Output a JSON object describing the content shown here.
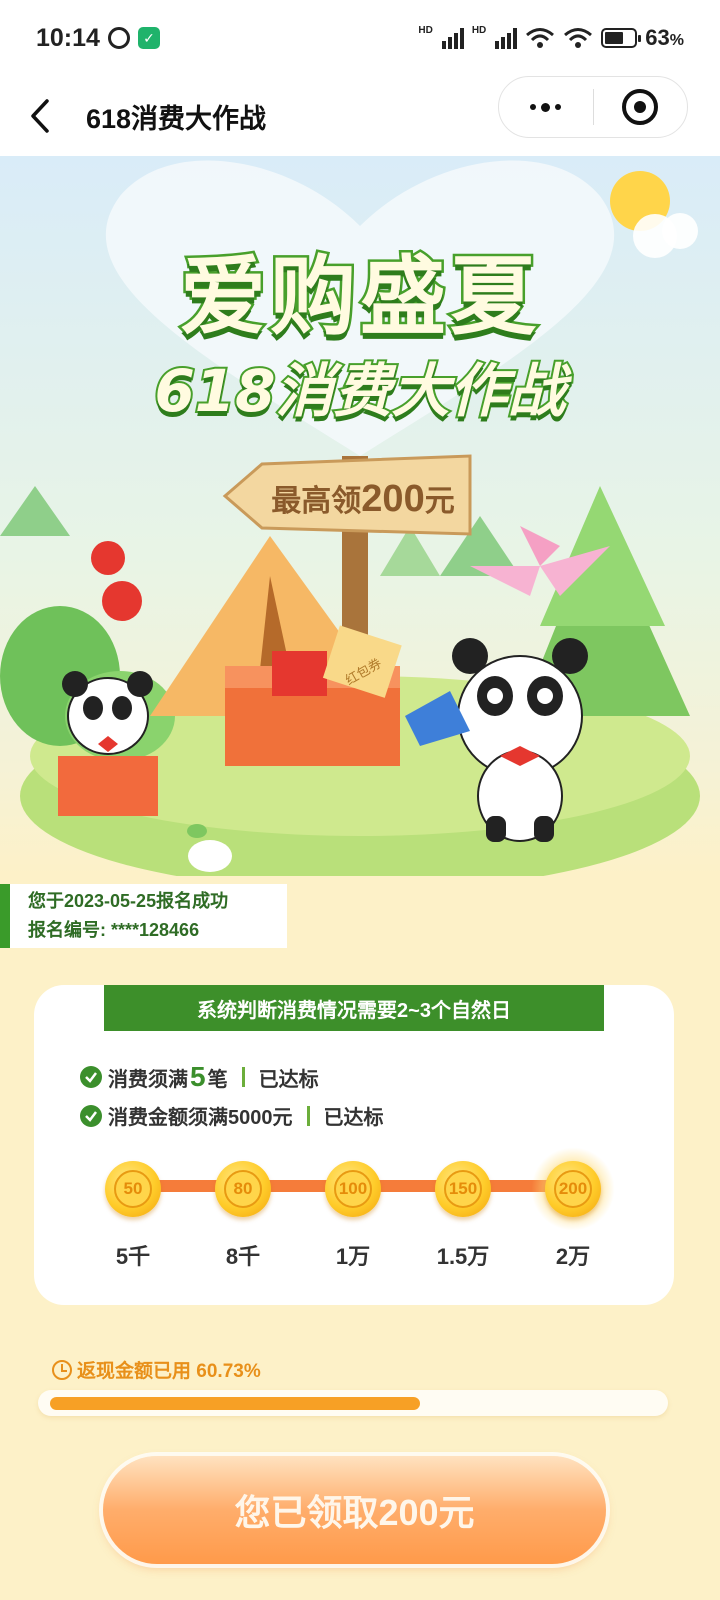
{
  "status_bar": {
    "time": "10:14",
    "signal1": "HD",
    "signal2": "HD",
    "battery": "63",
    "battery_unit": "%"
  },
  "nav": {
    "title": "618消费大作战"
  },
  "hero": {
    "title": "爱购盛夏",
    "subtitle": "618消费大作战",
    "sign_prefix": "最高领",
    "sign_amount": "200",
    "sign_suffix": "元",
    "box_text": "红包券"
  },
  "registration": {
    "line1": "您于2023-05-25报名成功",
    "line2": "报名编号: ****128466"
  },
  "task_card": {
    "banner": "系统判断消费情况需要2~3个自然日",
    "requirements": [
      {
        "text_before": "消费须满",
        "num": "5",
        "text_after": "笔",
        "status": "已达标"
      },
      {
        "text_before": "消费金额须满5000元",
        "num": "",
        "text_after": "",
        "status": "已达标"
      }
    ],
    "tiers": [
      {
        "reward": "50",
        "label": "5千"
      },
      {
        "reward": "80",
        "label": "8千"
      },
      {
        "reward": "100",
        "label": "1万"
      },
      {
        "reward": "150",
        "label": "1.5万"
      },
      {
        "reward": "200",
        "label": "2万"
      }
    ]
  },
  "cashback": {
    "label": "返现金额已用 60.73%",
    "used_fraction": 0.6073
  },
  "claim_button": {
    "label": "您已领取200元"
  },
  "colors": {
    "brand_green": "#3d8f2a",
    "accent_orange": "#f7a025",
    "page_bg": "#fdf1c8"
  }
}
